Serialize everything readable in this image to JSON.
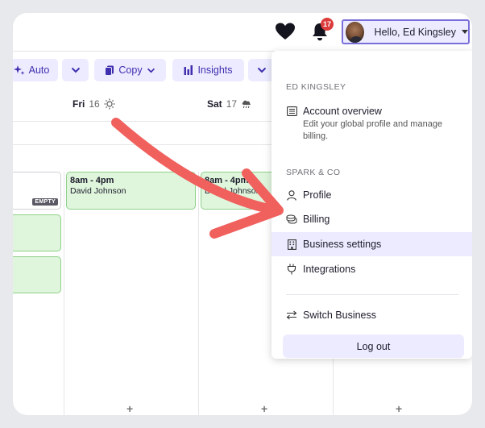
{
  "header": {
    "notification_count": "17",
    "user_greeting": "Hello, Ed Kingsley"
  },
  "toolbar": {
    "auto_label": "Auto",
    "copy_label": "Copy",
    "insights_label": "Insights"
  },
  "calendar": {
    "days": [
      {
        "name": "Fri",
        "number": "16",
        "weather_icon": "sun-icon"
      },
      {
        "name": "Sat",
        "number": "17",
        "weather_icon": "rain-cloud-icon"
      }
    ],
    "empty_badge": "EMPTY",
    "shifts": [
      {
        "time": "8am - 4pm",
        "employee": "David Johnson"
      },
      {
        "time": "8am - 4pm",
        "employee": "David Johnson"
      }
    ],
    "add_symbol": "+"
  },
  "menu": {
    "user_section": "ED KINGSLEY",
    "account_overview": {
      "label": "Account overview",
      "description": "Edit your global profile and manage billing."
    },
    "business_section": "SPARK & CO",
    "items": [
      {
        "label": "Profile",
        "icon": "person-icon"
      },
      {
        "label": "Billing",
        "icon": "coins-icon"
      },
      {
        "label": "Business settings",
        "icon": "building-icon"
      },
      {
        "label": "Integrations",
        "icon": "plug-icon"
      }
    ],
    "switch_business": "Switch Business",
    "logout": "Log out"
  },
  "colors": {
    "accent": "#3f2fae",
    "accent_bg": "#ecebff",
    "shift_bg": "#dff5dc",
    "arrow": "#f0605d",
    "badge": "#dc3b3b"
  }
}
